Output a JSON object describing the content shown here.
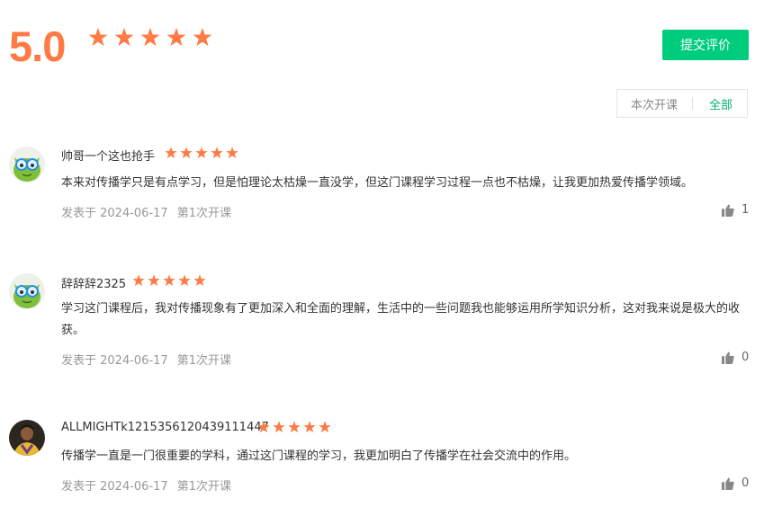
{
  "summary": {
    "score": "5.0",
    "stars": 5
  },
  "actions": {
    "submit_label": "提交评价"
  },
  "filter": {
    "current_label": "本次开课",
    "all_label": "全部",
    "selected": "全部"
  },
  "reviews": [
    {
      "username": "帅哥一个这也抢手",
      "stars": 5,
      "text": "本来对传播学只是有点学习，但是怕理论太枯燥一直没学，但这门课程学习过程一点也不枯燥，让我更加热爱传播学领域。",
      "date": "发表于 2024-06-17",
      "session": "第1次开课",
      "likes": "1",
      "avatar_icon": "green-monster-avatar"
    },
    {
      "username": "辞辞辞2325",
      "stars": 5,
      "text": "学习这门课程后，我对传播现象有了更加深入和全面的理解，生活中的一些问题我也能够运用所学知识分析，这对我来说是极大的收获。",
      "date": "发表于 2024-06-17",
      "session": "第1次开课",
      "likes": "0",
      "avatar_icon": "green-monster-avatar"
    },
    {
      "username": "ALLMIGHTk1215356120439111447",
      "stars": 5,
      "text": "传播学一直是一门很重要的学科，通过这门课程的学习，我更加明白了传播学在社会交流中的作用。",
      "date": "发表于 2024-06-17",
      "session": "第1次开课",
      "likes": "0",
      "avatar_icon": "photo-avatar"
    }
  ],
  "colors": {
    "accent_orange": "#ff7a45",
    "button_green": "#00cc7e",
    "link_green": "#00b36b"
  }
}
